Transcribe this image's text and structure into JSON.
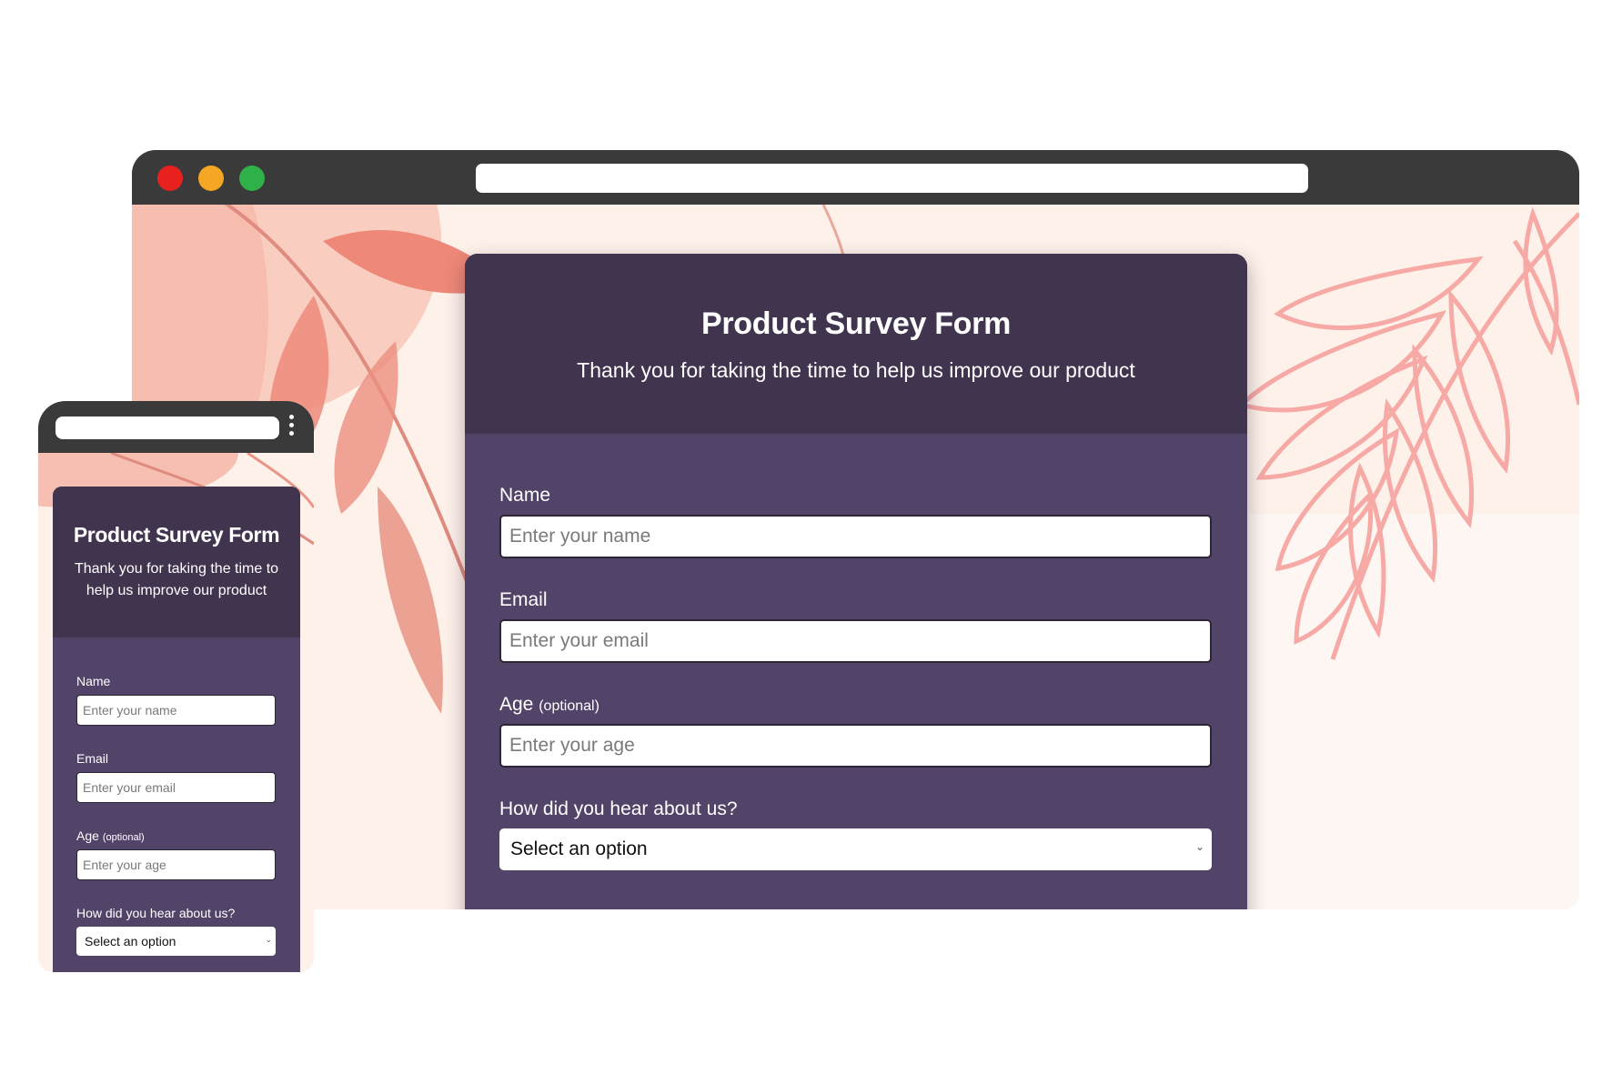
{
  "colors": {
    "header": "#41344f",
    "body": "#524368",
    "browser_bar": "#3a3a3b",
    "close_dot": "#e8211e",
    "minimize_dot": "#f5a623",
    "maximize_dot": "#2fb14a"
  },
  "form": {
    "title": "Product Survey Form",
    "subtitle": "Thank you for taking the time to help us improve our product",
    "fields": {
      "name": {
        "label": "Name",
        "placeholder": "Enter your name"
      },
      "email": {
        "label": "Email",
        "placeholder": "Enter your email"
      },
      "age": {
        "label": "Age",
        "optional": "(optional)",
        "placeholder": "Enter your age"
      },
      "referral": {
        "label": "How did you hear about us?",
        "selected": "Select an option"
      }
    }
  },
  "icons": {
    "select_chevron": "chevron-down-icon",
    "mobile_menu": "kebab-menu-icon"
  }
}
